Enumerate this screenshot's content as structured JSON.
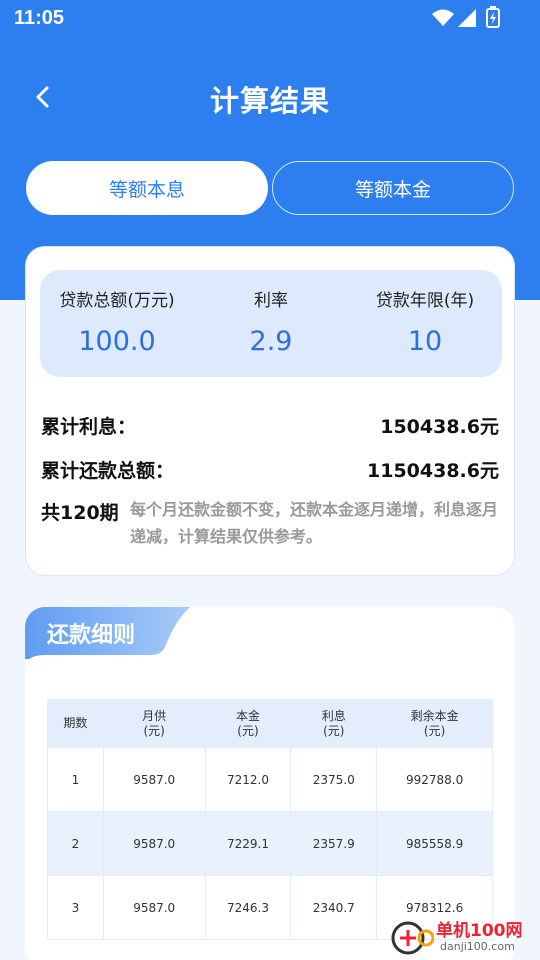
{
  "status_bar": {
    "time": "11:05"
  },
  "header": {
    "title": "计算结果"
  },
  "tabs": [
    {
      "label": "等额本息",
      "active": true
    },
    {
      "label": "等额本金",
      "active": false
    }
  ],
  "summary": {
    "params": [
      {
        "label": "贷款总额(万元)",
        "value": "100.0"
      },
      {
        "label": "利率",
        "value": "2.9"
      },
      {
        "label": "贷款年限(年)",
        "value": "10"
      }
    ],
    "total_interest_label": "累计利息：",
    "total_interest_value": "150438.6元",
    "total_payment_label": "累计还款总额：",
    "total_payment_value": "1150438.6元",
    "periods": "共120期",
    "note": "每个月还款金额不变，还款本金逐月递增，利息逐月递减，计算结果仅供参考。"
  },
  "detail": {
    "title": "还款细则",
    "columns": [
      {
        "l1": "期数",
        "l2": ""
      },
      {
        "l1": "月供",
        "l2": "(元)"
      },
      {
        "l1": "本金",
        "l2": "(元)"
      },
      {
        "l1": "利息",
        "l2": "(元)"
      },
      {
        "l1": "剩余本金",
        "l2": "(元)"
      }
    ],
    "rows": [
      [
        "1",
        "9587.0",
        "7212.0",
        "2375.0",
        "992788.0"
      ],
      [
        "2",
        "9587.0",
        "7229.1",
        "2357.9",
        "985558.9"
      ],
      [
        "3",
        "9587.0",
        "7246.3",
        "2340.7",
        "978312.6"
      ]
    ]
  },
  "watermark": {
    "text1": "单机100网",
    "text2": "danji100.com"
  },
  "colors": {
    "primary": "#2d7ff0",
    "value_blue": "#2d6ee0",
    "param_bg": "#dde9fc"
  }
}
